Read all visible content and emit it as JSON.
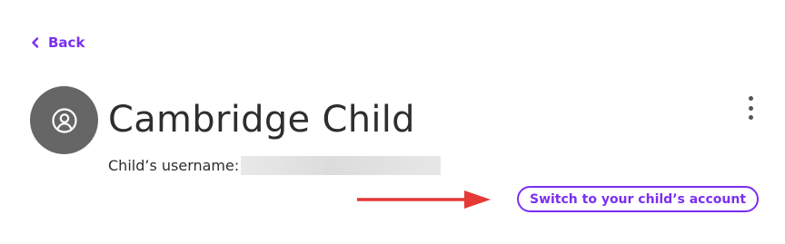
{
  "nav": {
    "back_label": "Back"
  },
  "profile": {
    "name": "Cambridge Child",
    "username_label": "Child’s username:",
    "avatar_icon": "user-circle-icon"
  },
  "actions": {
    "switch_account_label": "Switch to your child’s account",
    "more_options_icon": "kebab-menu-icon"
  },
  "colors": {
    "accent": "#7b2ff2",
    "annotation_arrow": "#e53935",
    "avatar_bg": "#666666"
  }
}
